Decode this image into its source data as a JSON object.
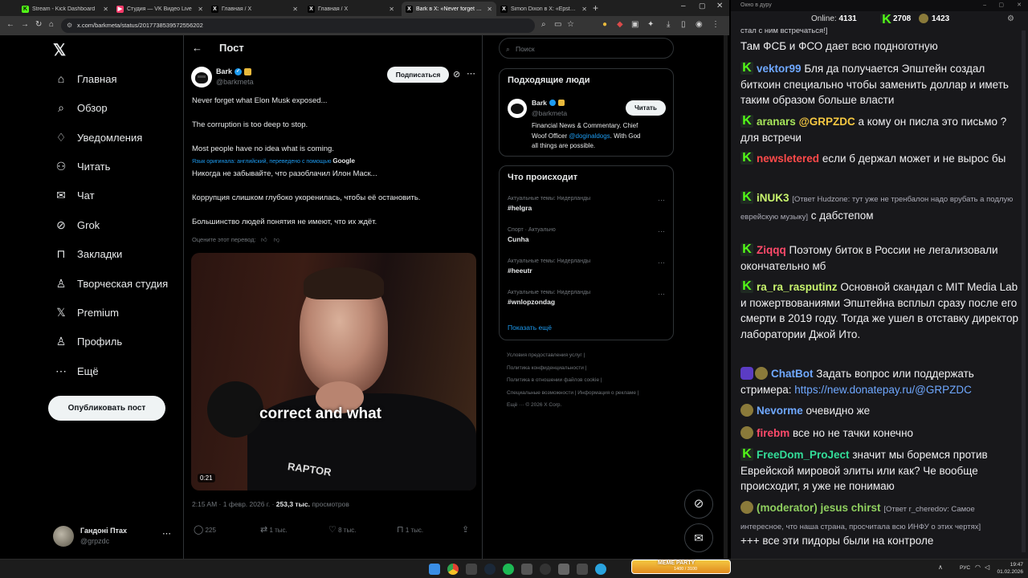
{
  "browser": {
    "tabs": [
      {
        "title": "Stream - Kick Dashboard",
        "fav": "K",
        "color": "#53fc18"
      },
      {
        "title": "Студия — VK Видео Live",
        "fav": "▶",
        "color": "#ff3b6b"
      },
      {
        "title": "Главная / X",
        "fav": "X",
        "color": "#000000"
      },
      {
        "title": "Главная / X",
        "fav": "X",
        "color": "#000000"
      },
      {
        "title": "Bark в X: «Never forget what El»",
        "fav": "X",
        "color": "#000000"
      },
      {
        "title": "Simon Dixon в X: «Epstein files»",
        "fav": "X",
        "color": "#000000"
      }
    ],
    "url": "x.com/barkmeta/status/2017738539572556202"
  },
  "x": {
    "nav": [
      {
        "label": "Главная",
        "icon": "home-icon",
        "glyph": "⌂"
      },
      {
        "label": "Обзор",
        "icon": "search-icon",
        "glyph": "⌕"
      },
      {
        "label": "Уведомления",
        "icon": "bell-icon",
        "glyph": "♢"
      },
      {
        "label": "Читать",
        "icon": "follow-icon",
        "glyph": "⚇"
      },
      {
        "label": "Чат",
        "icon": "mail-icon",
        "glyph": "✉"
      },
      {
        "label": "Grok",
        "icon": "grok-icon",
        "glyph": "⊘"
      },
      {
        "label": "Закладки",
        "icon": "bookmark-icon",
        "glyph": "⊓"
      },
      {
        "label": "Творческая студия",
        "icon": "studio-icon",
        "glyph": "♙"
      },
      {
        "label": "Premium",
        "icon": "x-premium-icon",
        "glyph": "𝕏"
      },
      {
        "label": "Профиль",
        "icon": "profile-icon",
        "glyph": "♙"
      },
      {
        "label": "Ещё",
        "icon": "more-icon",
        "glyph": "⋯"
      }
    ],
    "publish_label": "Опубликовать пост",
    "account": {
      "name": "Гандоні Птах",
      "handle": "@grpzdc"
    },
    "post": {
      "header": "Пост",
      "author": "Bark",
      "handle": "@barkmeta",
      "subscribe": "Подписаться",
      "lines": [
        "Never forget what Elon Musk exposed...",
        "The corruption is too deep to stop.",
        "Most people have no idea what is coming."
      ],
      "translation_note": "Язык оригинала: английский, переведено с помощью",
      "google": "Google",
      "translated": [
        "Никогда не забывайте, что разоблачил Илон Маск...",
        "Коррупция слишком глубоко укоренилась, чтобы её остановить.",
        "Большинство людей понятия не имеют, что их ждёт."
      ],
      "rate": "Оцените этот перевод:",
      "video_caption": "correct and what",
      "video_time": "0:21",
      "video_brand": "RAPTOR",
      "time": "2:15 AM · 1 февр. 2026 г. ·",
      "views": "253,3 тыс.",
      "views_label": "просмотров",
      "stats": {
        "replies": "225",
        "reposts": "1 тыс.",
        "likes": "8 тыс.",
        "bookmarks": "1 тыс."
      }
    },
    "search_placeholder": "Поиск",
    "who_to_follow": {
      "title": "Подходящие люди",
      "name": "Bark",
      "handle": "@barkmeta",
      "button": "Читать",
      "bio1": "Financial News & Commentary. Chief",
      "bio2a": "Woof Officer ",
      "bio2link": "@doginaldogs",
      "bio2b": ". With God",
      "bio3": "all things are possible."
    },
    "trends": {
      "title": "Что происходит",
      "items": [
        {
          "context": "Актуальные темы: Нидерланды",
          "topic": "#helgra"
        },
        {
          "context": "Спорт · Актуально",
          "topic": "Cunha"
        },
        {
          "context": "Актуальные темы: Нидерланды",
          "topic": "#heeutr"
        },
        {
          "context": "Актуальные темы: Нидерланды",
          "topic": "#wnlopzondag"
        }
      ],
      "show_more": "Показать ещё"
    },
    "footer": {
      "l1a": "Условия предоставления услуг",
      "l2a": "Политика конфиденциальности",
      "l3a": "Политика в отношении файлов cookie",
      "l4a": "Специальные возможности",
      "l4b": "Информация о рекламе",
      "l5a": "Ещё ···",
      "l5b": "© 2026 X Corp."
    }
  },
  "chat": {
    "window_title": "Окно в дуру",
    "online_label": "Online:",
    "online": "4131",
    "kick_count": "2708",
    "other_count": "1423",
    "messages": [
      {
        "badge": "none",
        "user": "",
        "color": "#ffffff",
        "reply": "",
        "text": "стал с ним встречаться!]"
      },
      {
        "badge": "none",
        "user": "",
        "color": "#ffffff",
        "reply": "",
        "text": "Там ФСБ и ФСО дает всю подноготную"
      },
      {
        "badge": "kick",
        "user": "vektor99",
        "color": "#6fa8ff",
        "reply": "",
        "text": "Бля да получается Эпштейн создал биткоин специально чтобы заменить доллар и иметь таким образом больше власти"
      },
      {
        "badge": "kick",
        "user": "aranars",
        "color": "#a6e35a",
        "reply": "",
        "text": "",
        "mention": "@GRPZDC",
        "text2": " а кому он писла это письмо ? для встречи"
      },
      {
        "badge": "kick",
        "user": "newsletered",
        "color": "#ff4a4a",
        "reply": "",
        "text": "если б держал может и не вырос бы"
      },
      {
        "badge": "kick",
        "user": "iNUK3",
        "color": "#c9f56e",
        "reply": "[Ответ Hudzone: тут уже не тренбалон надо врубать а подлую еврейскую музыку]",
        "text": "с дабстепом"
      },
      {
        "badge": "kick",
        "user": "Ziqqq",
        "color": "#ff4a6a",
        "reply": "",
        "text": "Поэтому биток в России не легализовали окончательно мб"
      },
      {
        "badge": "kick",
        "user": "ra_ra_rasputinz",
        "color": "#c9f56e",
        "reply": "",
        "text": "Основной скандал с MIT Media Lab и пожертвованиями Эпштейна всплыл сразу после его смерти в 2019 году. Тогда же ушел в отставку директор лаборатории Джой Ито."
      },
      {
        "badge": "bot",
        "user": "ChatBot",
        "color": "#6fa8ff",
        "reply": "",
        "text": "Задать вопрос или поддержать стримера: ",
        "link": "https://new.donatepay.ru/@GRPZDC"
      },
      {
        "badge": "sub",
        "user": "Nevorme",
        "color": "#6fa8ff",
        "reply": "",
        "text": "очевидно же"
      },
      {
        "badge": "sub",
        "user": "firebm",
        "color": "#ff4a6a",
        "reply": "",
        "text": "все но не тачки конечно"
      },
      {
        "badge": "kick",
        "user": "FreeDom_ProJect",
        "color": "#33dd99",
        "reply": "",
        "text": "значит мы боремся против Еврейской мировой элиты или как? Че вообще происходит, я уже не понимаю"
      },
      {
        "badge": "sub",
        "user": "(moderator) jesus chirst",
        "color": "#8fcf5f",
        "reply": "[Ответ r_cheredov: Самое интересное, что наша страна, просчитала всю ИНФУ о этих чертях]",
        "text": ""
      },
      {
        "badge": "none",
        "user": "",
        "color": "#ffffff",
        "reply": "",
        "text": "+++ все эти пидоры были на контроле"
      }
    ]
  },
  "taskbar": {
    "meme_party": "MEME PARTY",
    "meme_count": "1400 / 3100",
    "lang": "РУС",
    "time": "19:47",
    "date": "01.02.2026"
  }
}
